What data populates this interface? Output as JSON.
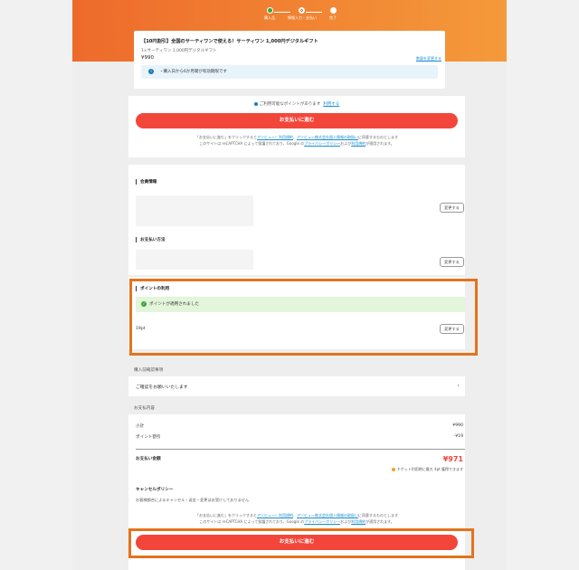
{
  "steps": [
    {
      "label": "購入品",
      "state": "done"
    },
    {
      "label": "情報入力・支払い",
      "state": "active"
    },
    {
      "label": "完了",
      "state": "todo"
    }
  ],
  "product": {
    "title": "【10円割引】全国のサーティワンで使える！サーティワン 1,000円デジタルギフト",
    "subtitle": "1×サーティワン 1,000円デジタルギフト",
    "price": "¥990",
    "change_link": "数量を変更する",
    "notice": "・購入日から6か月間が有効期限です"
  },
  "coupon": {
    "text": "ご利用可能なポイントがあります",
    "link": "利用する"
  },
  "primary_button": "お支払いに進む",
  "legal_top": {
    "l1_a": "「お支払いに進む」をクリックすると",
    "l1_link1": "アソビュー！利用規約",
    "l1_sep": "、",
    "l1_link2": "アソビュー株式会社個人情報の取扱い",
    "l1_b": "に同意するものとします",
    "l2_a": "このサイトは reCAPTCHA によって保護されており、Google の",
    "l2_link1": "プライバシーポリシー",
    "l2_mid": "および",
    "l2_link2": "利用規約",
    "l2_b": "が適用されます。"
  },
  "member": {
    "title": "会員情報",
    "change": "変更する"
  },
  "payment_method": {
    "title": "お支払い方法",
    "change": "変更する"
  },
  "points": {
    "title": "ポイントの利用",
    "applied": "ポイントが適用されました",
    "amount": "19pt",
    "change": "変更する"
  },
  "confirm": {
    "section": "購入前確認事項",
    "row": "ご確認をお願いいたします"
  },
  "payment": {
    "section": "お支払内容",
    "subtotal_label": "小計",
    "subtotal_value": "¥990",
    "discount_label": "ポイント割引",
    "discount_value": "-¥19",
    "total_label": "お支払い金額",
    "total_value": "¥971",
    "earn_note": "チケット利用時に最大 4pt 獲得できます",
    "cancel_title": "キャンセルポリシー",
    "cancel_text": "お客様都合によるキャンセル・返金・変更はお受けしておりません"
  },
  "colors": {
    "accent": "#ee6a2b",
    "button": "#f3463a",
    "highlight": "#e4731c",
    "link": "#1a8fd0"
  }
}
